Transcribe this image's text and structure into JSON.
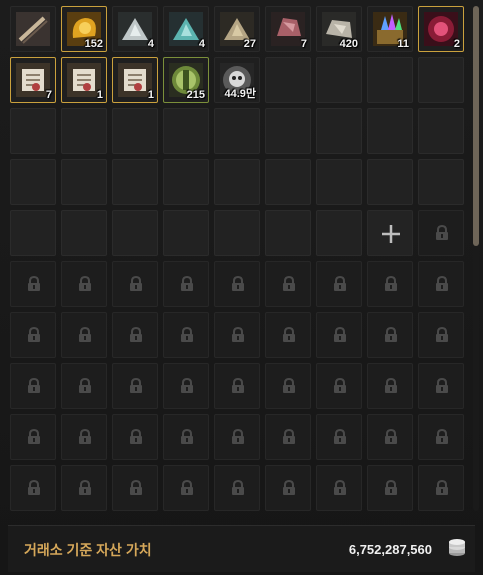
{
  "inventory": {
    "slots": [
      {
        "kind": "item",
        "icon": "bow-icon",
        "qty": "",
        "border": "none"
      },
      {
        "kind": "item",
        "icon": "gold-bag-icon",
        "qty": "152",
        "border": "gold"
      },
      {
        "kind": "item",
        "icon": "silver-stone-icon",
        "qty": "4",
        "border": "none"
      },
      {
        "kind": "item",
        "icon": "blue-stone-icon",
        "qty": "4",
        "border": "none"
      },
      {
        "kind": "item",
        "icon": "gold-stone-icon",
        "qty": "27",
        "border": "none"
      },
      {
        "kind": "item",
        "icon": "red-ore-icon",
        "qty": "7",
        "border": "none"
      },
      {
        "kind": "item",
        "icon": "silver-ore-icon",
        "qty": "420",
        "border": "none"
      },
      {
        "kind": "item",
        "icon": "crystal-box-icon",
        "qty": "11",
        "border": "none"
      },
      {
        "kind": "item",
        "icon": "red-crystal-icon",
        "qty": "2",
        "border": "gold"
      },
      {
        "kind": "item",
        "icon": "scroll-icon",
        "qty": "7",
        "border": "gold"
      },
      {
        "kind": "item",
        "icon": "scroll-icon",
        "qty": "1",
        "border": "gold"
      },
      {
        "kind": "item",
        "icon": "scroll-icon",
        "qty": "1",
        "border": "gold"
      },
      {
        "kind": "item",
        "icon": "green-coin-icon",
        "qty": "215",
        "border": "green"
      },
      {
        "kind": "item",
        "icon": "skull-coin-icon",
        "qty": "44.9만",
        "border": "none"
      },
      {
        "kind": "empty"
      },
      {
        "kind": "empty"
      },
      {
        "kind": "empty"
      },
      {
        "kind": "empty"
      },
      {
        "kind": "empty"
      },
      {
        "kind": "empty"
      },
      {
        "kind": "empty"
      },
      {
        "kind": "empty"
      },
      {
        "kind": "empty"
      },
      {
        "kind": "empty"
      },
      {
        "kind": "empty"
      },
      {
        "kind": "empty"
      },
      {
        "kind": "empty"
      },
      {
        "kind": "empty"
      },
      {
        "kind": "empty"
      },
      {
        "kind": "empty"
      },
      {
        "kind": "empty"
      },
      {
        "kind": "empty"
      },
      {
        "kind": "empty"
      },
      {
        "kind": "empty"
      },
      {
        "kind": "empty"
      },
      {
        "kind": "empty"
      },
      {
        "kind": "empty"
      },
      {
        "kind": "empty"
      },
      {
        "kind": "empty"
      },
      {
        "kind": "empty"
      },
      {
        "kind": "empty"
      },
      {
        "kind": "empty"
      },
      {
        "kind": "empty"
      },
      {
        "kind": "plus"
      },
      {
        "kind": "locked"
      },
      {
        "kind": "locked"
      },
      {
        "kind": "locked"
      },
      {
        "kind": "locked"
      },
      {
        "kind": "locked"
      },
      {
        "kind": "locked"
      },
      {
        "kind": "locked"
      },
      {
        "kind": "locked"
      },
      {
        "kind": "locked"
      },
      {
        "kind": "locked"
      },
      {
        "kind": "locked"
      },
      {
        "kind": "locked"
      },
      {
        "kind": "locked"
      },
      {
        "kind": "locked"
      },
      {
        "kind": "locked"
      },
      {
        "kind": "locked"
      },
      {
        "kind": "locked"
      },
      {
        "kind": "locked"
      },
      {
        "kind": "locked"
      },
      {
        "kind": "locked"
      },
      {
        "kind": "locked"
      },
      {
        "kind": "locked"
      },
      {
        "kind": "locked"
      },
      {
        "kind": "locked"
      },
      {
        "kind": "locked"
      },
      {
        "kind": "locked"
      },
      {
        "kind": "locked"
      },
      {
        "kind": "locked"
      },
      {
        "kind": "locked"
      },
      {
        "kind": "locked"
      },
      {
        "kind": "locked"
      },
      {
        "kind": "locked"
      },
      {
        "kind": "locked"
      },
      {
        "kind": "locked"
      },
      {
        "kind": "locked"
      },
      {
        "kind": "locked"
      },
      {
        "kind": "locked"
      },
      {
        "kind": "locked"
      },
      {
        "kind": "locked"
      },
      {
        "kind": "locked"
      },
      {
        "kind": "locked"
      },
      {
        "kind": "locked"
      },
      {
        "kind": "locked"
      },
      {
        "kind": "locked"
      },
      {
        "kind": "locked"
      },
      {
        "kind": "locked"
      }
    ]
  },
  "footer": {
    "label": "거래소 기준 자산 가치",
    "value": "6,752,287,560",
    "icon": "silver-coins-icon"
  },
  "colors": {
    "accent_gold": "#caa13d",
    "label_gold": "#d6a85a"
  }
}
